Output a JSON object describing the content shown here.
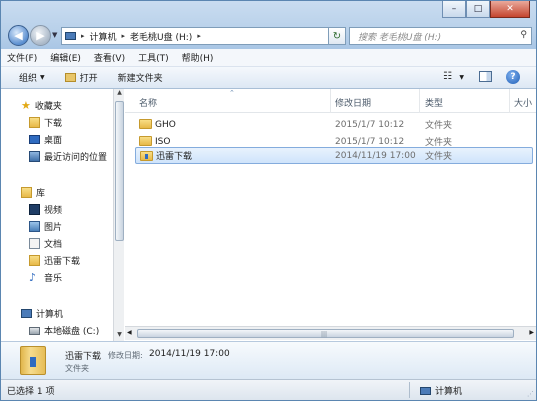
{
  "window": {
    "minimize_label": "–",
    "maximize_label": "□",
    "close_label": "✕"
  },
  "nav": {
    "back_glyph": "◀",
    "forward_glyph": "▶",
    "dropdown_glyph": "▼"
  },
  "address": {
    "crumbs": [
      "计算机",
      "老毛桃U盘 (H:)"
    ],
    "separator": "▸"
  },
  "search": {
    "placeholder": "搜索 老毛桃U盘 (H:)"
  },
  "menu": {
    "items": [
      "文件(F)",
      "编辑(E)",
      "查看(V)",
      "工具(T)",
      "帮助(H)"
    ]
  },
  "commands": {
    "organize": "组织",
    "open": "打开",
    "new_folder": "新建文件夹",
    "help_glyph": "?"
  },
  "sidebar": {
    "favorites": {
      "title": "收藏夹",
      "items": [
        "下载",
        "桌面",
        "最近访问的位置"
      ]
    },
    "libraries": {
      "title": "库",
      "items": [
        "视频",
        "图片",
        "文档",
        "迅雷下载",
        "音乐"
      ]
    },
    "computer": {
      "title": "计算机",
      "items": [
        "本地磁盘 (C:)"
      ]
    }
  },
  "columns": {
    "name": "名称",
    "date": "修改日期",
    "type": "类型",
    "size": "大小"
  },
  "files": [
    {
      "name": "GHO",
      "date": "2015/1/7 10:12",
      "type": "文件夹"
    },
    {
      "name": "ISO",
      "date": "2015/1/7 10:12",
      "type": "文件夹"
    },
    {
      "name": "迅雷下载",
      "date": "2014/11/19 17:00",
      "type": "文件夹"
    }
  ],
  "details": {
    "name": "迅雷下载",
    "date_label": "修改日期:",
    "date_value": "2014/11/19 17:00",
    "type": "文件夹"
  },
  "status": {
    "selection": "已选择 1 项",
    "location": "计算机"
  },
  "colors": {
    "accent": "#5b86b1",
    "selection": "#cfe4fb",
    "folder": "#e7b948"
  }
}
